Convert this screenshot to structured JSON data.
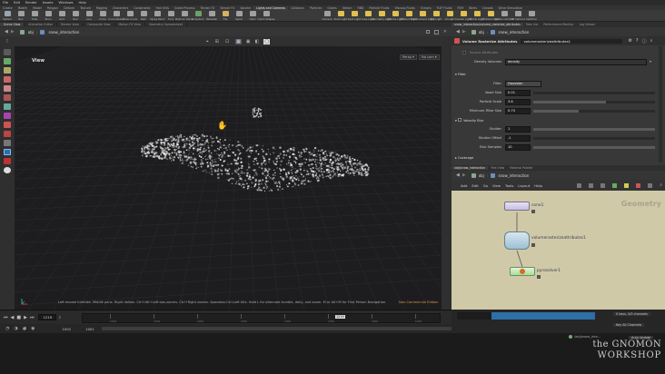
{
  "menubar": [
    "File",
    "Edit",
    "Render",
    "Assets",
    "Windows",
    "Help"
  ],
  "shelf_tabs": [
    {
      "label": "Create",
      "sel": false
    },
    {
      "label": "Modify",
      "sel": false
    },
    {
      "label": "Model",
      "sel": false
    },
    {
      "label": "Polygon",
      "sel": false
    },
    {
      "label": "Deform",
      "sel": false
    },
    {
      "label": "Texture",
      "sel": false
    },
    {
      "label": "Rigging",
      "sel": false
    },
    {
      "label": "Characters",
      "sel": false
    },
    {
      "label": "Constraints",
      "sel": false
    },
    {
      "label": "Hair Utils",
      "sel": false
    },
    {
      "label": "Guide Process",
      "sel": false
    },
    {
      "label": "Terrain FX",
      "sel": false
    },
    {
      "label": "Simple FX",
      "sel": false
    },
    {
      "label": "Volume",
      "sel": false
    },
    {
      "label": "Lights and Cameras",
      "sel": true
    },
    {
      "label": "Collisions",
      "sel": false
    },
    {
      "label": "Particles",
      "sel": false
    },
    {
      "label": "Grains",
      "sel": false
    },
    {
      "label": "Vellum",
      "sel": false
    },
    {
      "label": "RBD",
      "sel": false
    },
    {
      "label": "Particle Fluids",
      "sel": false
    },
    {
      "label": "Viscous Fluids",
      "sel": false
    },
    {
      "label": "Oceans",
      "sel": false
    },
    {
      "label": "FLIP Fluids",
      "sel": false
    },
    {
      "label": "FEM",
      "sel": false
    },
    {
      "label": "Wires",
      "sel": false
    },
    {
      "label": "Crowds",
      "sel": false
    },
    {
      "label": "Drive Simulation",
      "sel": false
    }
  ],
  "shelf_tools_left": [
    {
      "label": "Sphere",
      "color": "#9aa4b0"
    },
    {
      "label": "Box",
      "color": "#a0a0a0"
    },
    {
      "label": "Tube",
      "color": "#a0a0a0"
    },
    {
      "label": "Torus",
      "color": "#a0a0a0"
    },
    {
      "label": "Grid",
      "color": "#a0a0a0"
    },
    {
      "label": "Null",
      "color": "#a0a0a0"
    },
    {
      "label": "Line",
      "color": "#a0a0a0"
    },
    {
      "label": "Circle",
      "color": "#a0a0a0"
    },
    {
      "label": "Curve Bezier",
      "color": "#a0a0a0"
    },
    {
      "label": "Draw Curve",
      "color": "#a0a0a0"
    },
    {
      "label": "Path",
      "color": "#a0a0a0"
    },
    {
      "label": "Spray Paint",
      "color": "#a0a0a0"
    },
    {
      "label": "Font",
      "color": "#a0a0a0"
    },
    {
      "label": "Platonic Solids",
      "color": "#a0a0a0"
    },
    {
      "label": "L-System",
      "color": "#6aa06a"
    },
    {
      "label": "Metaball",
      "color": "#a0a0a0"
    },
    {
      "label": "File",
      "color": "#d9b060"
    },
    {
      "label": "Spiral",
      "color": "#a0a0a0"
    },
    {
      "label": "Helix",
      "color": "#a0a0a0"
    },
    {
      "label": "Quick Shapes",
      "color": "#a0a0a0"
    }
  ],
  "shelf_tools_right": [
    {
      "label": "Camera",
      "color": "#a0a0a0"
    },
    {
      "label": "Point Light",
      "color": "#e0c050"
    },
    {
      "label": "Spot Light",
      "color": "#e0c050"
    },
    {
      "label": "Area Light",
      "color": "#e0c050"
    },
    {
      "label": "Geometry Light",
      "color": "#e0c050"
    },
    {
      "label": "Volume Light",
      "color": "#e0c050"
    },
    {
      "label": "Distant Light",
      "color": "#e0c050"
    },
    {
      "label": "Environment Light",
      "color": "#e0c050"
    },
    {
      "label": "Sky Light",
      "color": "#e0c050"
    },
    {
      "label": "GI Light",
      "color": "#e0c050"
    },
    {
      "label": "Caustic Light",
      "color": "#e0c050"
    },
    {
      "label": "Portal Light",
      "color": "#e0c050"
    },
    {
      "label": "Ambient Light",
      "color": "#e0c050"
    },
    {
      "label": "Stereo Camera",
      "color": "#a0a0a0"
    },
    {
      "label": "VR Camera",
      "color": "#a0a0a0"
    },
    {
      "label": "Switcher",
      "color": "#a0a0a0"
    }
  ],
  "viewport_tabs": [
    {
      "label": "Scene View",
      "sel": true
    },
    {
      "label": "Animation Editor",
      "sel": false
    },
    {
      "label": "Render View",
      "sel": false
    },
    {
      "label": "Composite View",
      "sel": false
    },
    {
      "label": "Motion FX View",
      "sel": false
    },
    {
      "label": "Geometry Spreadsheet",
      "sel": false
    }
  ],
  "viewport_path": {
    "obj": "obj",
    "node": "snow_interaction"
  },
  "viewport": {
    "label": "View",
    "persp": "Persp ▾",
    "cam": "No cam ▾",
    "hint": "Left mouse tumbles. Middle pans. Right dollies. Ctrl+Alt+Left box-zooms. Ctrl+Right zooms. Spacebar-Ctrl-Left tilts. Hold L for alternate tumble, dolly, and zoom. M or Alt+M for First Person Navigation.",
    "watermark": "Non-Commercial Edition"
  },
  "timeline": {
    "frame": "1219",
    "start": "1001",
    "start2": "1001",
    "end": "1468",
    "end2": "1468",
    "marker": "1219",
    "ticks": [
      "1100",
      "1150",
      "1200",
      "1250",
      "1300",
      "1350",
      "1400",
      "1450"
    ]
  },
  "param_tabs": [
    {
      "label": "snow_interaction/volume_rasterize_attributes",
      "sel": true
    },
    {
      "label": "Take List",
      "sel": false
    },
    {
      "label": "Performance Monitor",
      "sel": false
    },
    {
      "label": "Log Viewer",
      "sel": false
    }
  ],
  "param_path": {
    "obj": "obj",
    "node": "snow_interaction"
  },
  "param_header": {
    "type": "Volume Rasterize Attributes",
    "name": "volumerasterizeattributes1"
  },
  "params": {
    "source_attributes_label": "Source Attributes",
    "density_label": "Density Volumes",
    "density_value": "density",
    "filter_section": "Filter",
    "filter_label": "Filter",
    "filter_value": "Gaussian",
    "voxel_size_label": "Voxel Size",
    "voxel_size_value": "0.01",
    "particle_scale_label": "Particle Scale",
    "particle_scale_value": "3.6",
    "particle_scale_frac": 0.6,
    "min_filter_label": "Minimum Filter Size",
    "min_filter_value": "0.75",
    "min_filter_frac": 0.375,
    "velocity_section": "Velocity Blur",
    "shutter_label": "Shutter",
    "shutter_value": "1",
    "shutter_frac": 1.0,
    "shutter_offset_label": "Shutter Offset",
    "shutter_offset_value": "-1",
    "shutter_offset_frac": 0.0,
    "blur_samples_label": "Blur Samples",
    "blur_samples_value": "10",
    "blur_samples_frac": 1.0,
    "coverage_section": "Coverage"
  },
  "net_tabs": [
    {
      "label": "/obj/snow_interaction",
      "sel": true
    },
    {
      "label": "Tree View",
      "sel": false
    },
    {
      "label": "Material Palette",
      "sel": false
    }
  ],
  "net_path": {
    "obj": "obj",
    "node": "snow_interaction"
  },
  "net_menu": [
    "Add",
    "Edit",
    "Go",
    "View",
    "Tools",
    "Layout",
    "Help"
  ],
  "network": {
    "context_label": "Geometry",
    "nodes": [
      {
        "label": "cone1"
      },
      {
        "label": "volumerasterizeattributes1"
      },
      {
        "label": "pyrosolver1"
      }
    ]
  },
  "br_panel": {
    "keys": "0 keys, 0/0 channels",
    "all_channels": "Key All Channels",
    "auto_update": "Auto Update"
  },
  "statusbar": {
    "path": "/obj/snow_inte..."
  },
  "brand": {
    "line1": "the GNOMON",
    "line2": "WORKSHOP"
  }
}
